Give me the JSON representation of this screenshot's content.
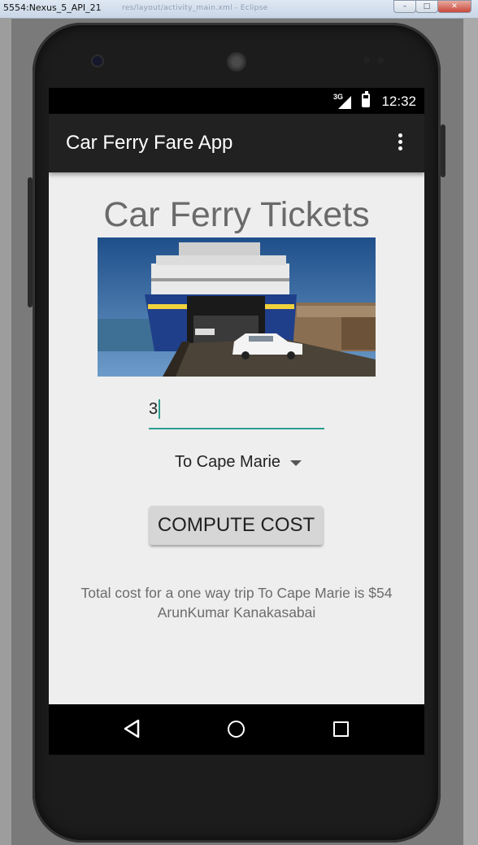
{
  "window": {
    "title": "5554:Nexus_5_API_21",
    "background_title": "res/layout/activity_main.xml - Eclipse",
    "controls": [
      "–",
      "□",
      "✕"
    ]
  },
  "status_bar": {
    "network": "3G",
    "time": "12:32"
  },
  "app_bar": {
    "title": "Car Ferry Fare App",
    "overflow_icon": "more-vert-icon"
  },
  "main": {
    "heading": "Car Ferry Tickets",
    "quantity_value": "3",
    "destination": "To Cape Marie",
    "compute_button": "COMPUTE COST",
    "result_line": "Total cost for a one way trip To Cape Marie is $54",
    "author_line": "ArunKumar Kanakasabai"
  },
  "nav_bar": {
    "icons": [
      "back-icon",
      "home-icon",
      "recent-apps-icon"
    ]
  },
  "colors": {
    "app_bar": "#212121",
    "content_bg": "#eeeeee",
    "accent": "#2d9c8f",
    "heading_text": "#6a6a6a",
    "button_bg": "#d6d6d6"
  }
}
